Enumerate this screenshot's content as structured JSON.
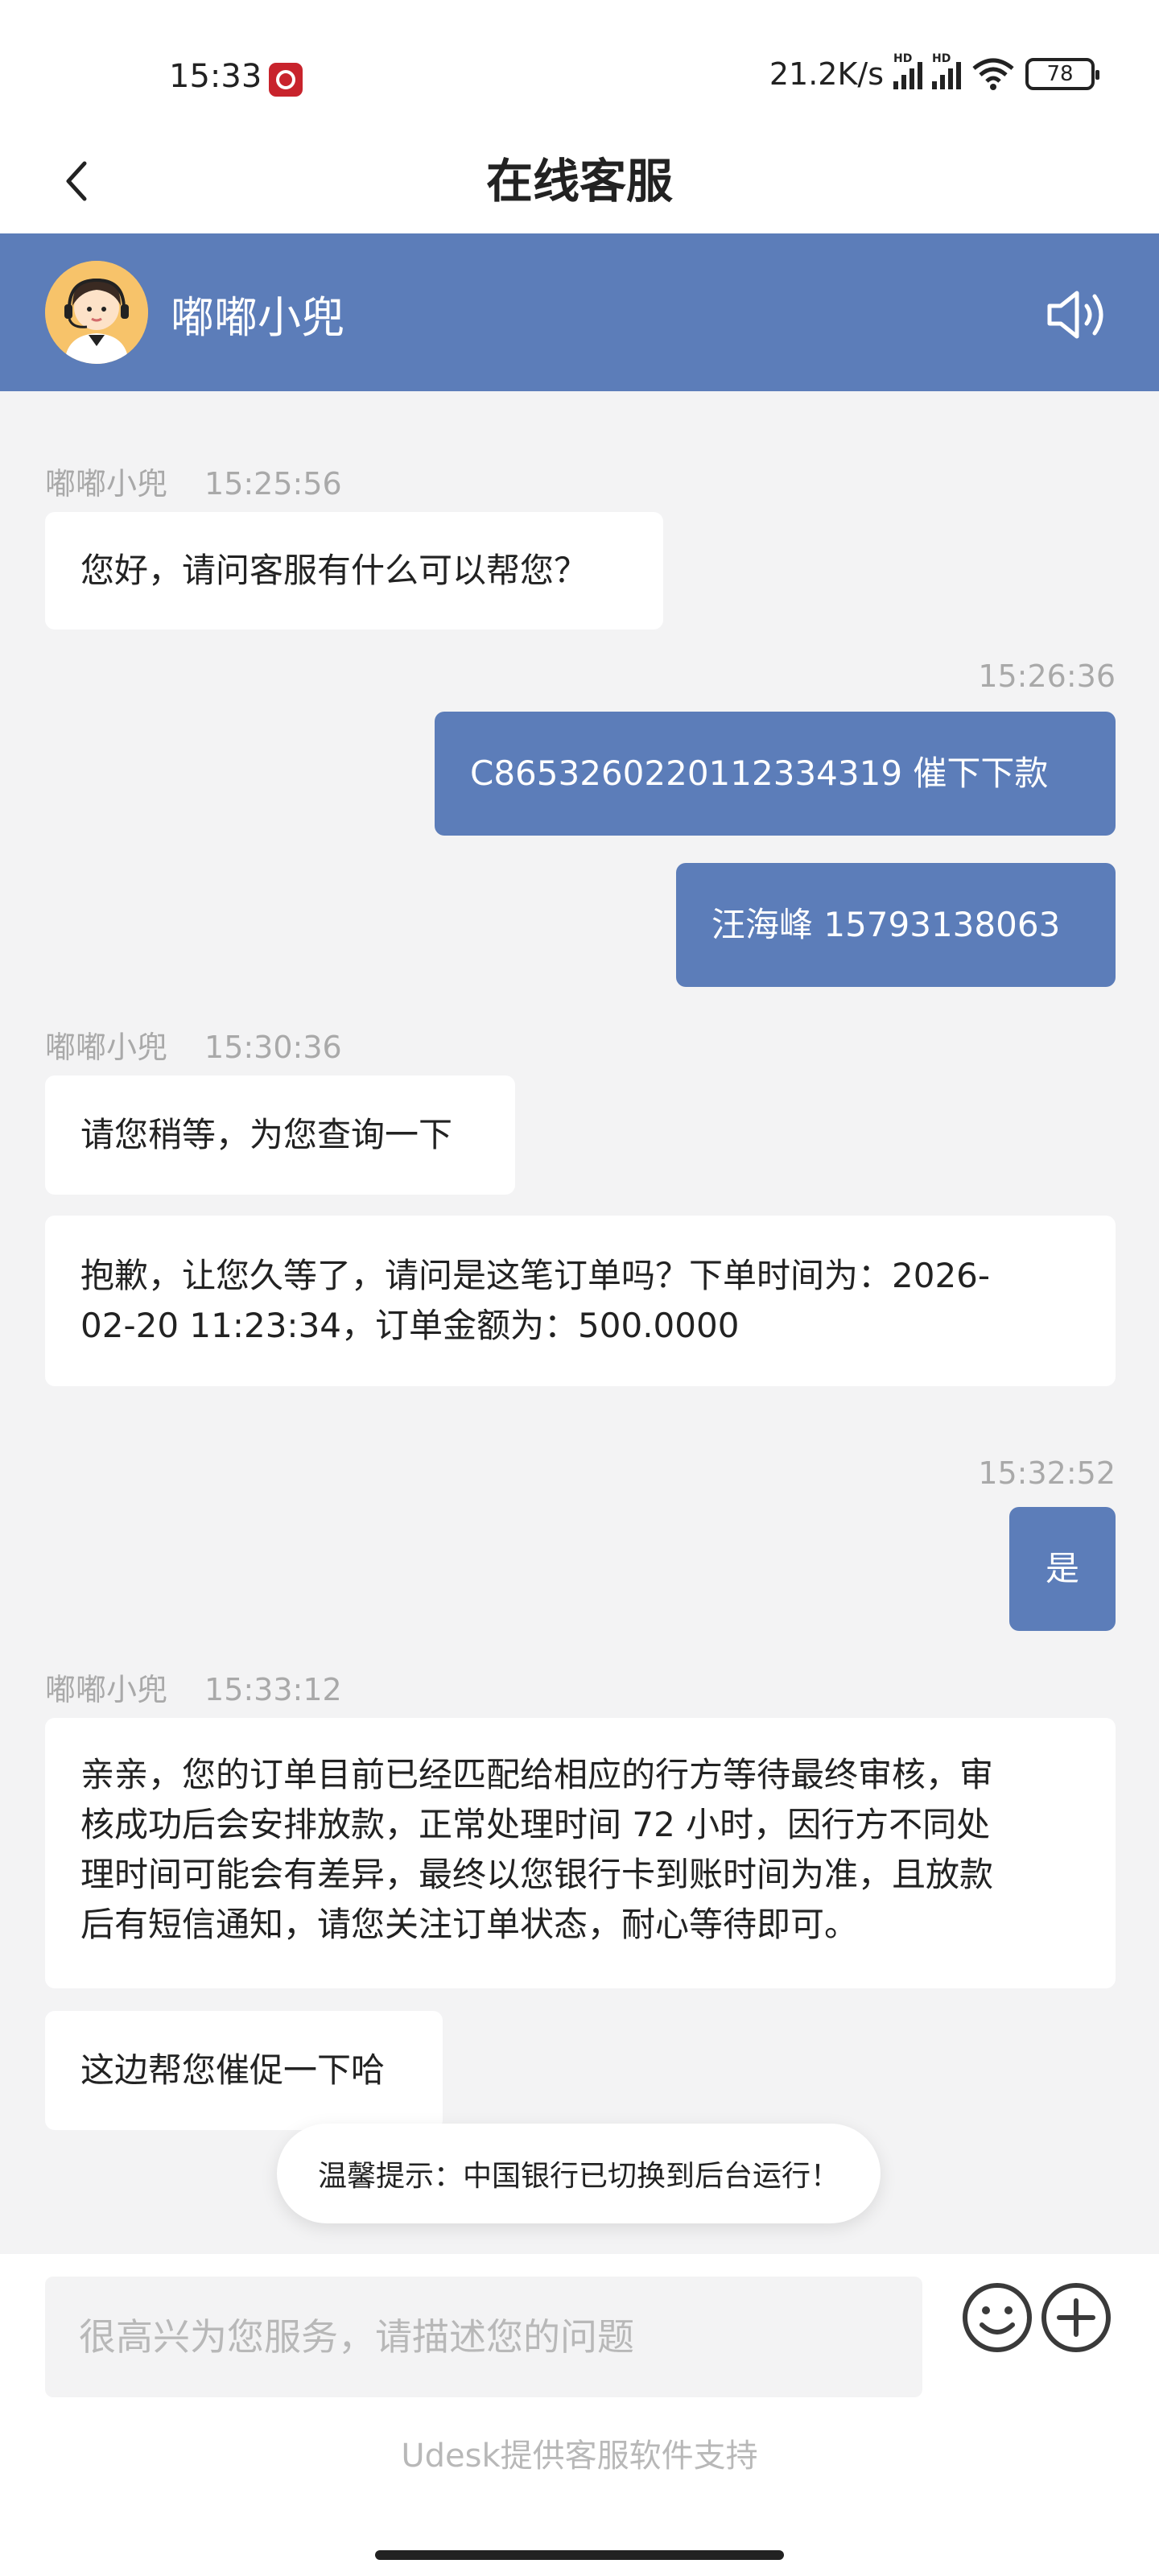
{
  "status_bar": {
    "time": "15:33",
    "net_speed": "21.2K/s",
    "sim1_label": "HD",
    "sim2_label": "HD",
    "battery": "78"
  },
  "header": {
    "title": "在线客服"
  },
  "agent": {
    "name": "嘟嘟小兜"
  },
  "messages": {
    "m1": {
      "sender": "嘟嘟小兜",
      "time": "15:25:56",
      "text": "您好，请问客服有什么可以帮您？"
    },
    "m2": {
      "time": "15:26:36",
      "text": "C8653260220112334319 催下下款"
    },
    "m3": {
      "text": "汪海峰 15793138063"
    },
    "m4": {
      "sender": "嘟嘟小兜",
      "time": "15:30:36",
      "text": "请您稍等，为您查询一下"
    },
    "m5": {
      "line1": "抱歉，让您久等了，请问是这笔订单吗？下单时间为：2026-",
      "line2": "02-20 11:23:34，订单金额为：500.0000"
    },
    "m6": {
      "time": "15:32:52",
      "text": "是"
    },
    "m7": {
      "sender": "嘟嘟小兜",
      "time": "15:33:12",
      "line1": "亲亲，您的订单目前已经匹配给相应的行方等待最终审核，审",
      "line2": "核成功后会安排放款，正常处理时间 72 小时，因行方不同处",
      "line3": "理时间可能会有差异，最终以您银行卡到账时间为准，且放款",
      "line4": "后有短信通知，请您关注订单状态，耐心等待即可。"
    },
    "m8": {
      "text": "这边帮您催促一下哈"
    }
  },
  "toast": {
    "text": "温馨提示：中国银行已切换到后台运行！"
  },
  "input": {
    "placeholder": "很高兴为您服务，请描述您的问题"
  },
  "footer": {
    "powered_by": "Udesk提供客服软件支持"
  },
  "colors": {
    "accent": "#5c7db9",
    "background": "#f3f3f4",
    "app_badge": "#c8232c"
  },
  "icons": [
    "back-icon",
    "speaker-icon",
    "emoji-icon",
    "plus-icon",
    "wifi-icon",
    "battery-icon",
    "signal-icon"
  ]
}
